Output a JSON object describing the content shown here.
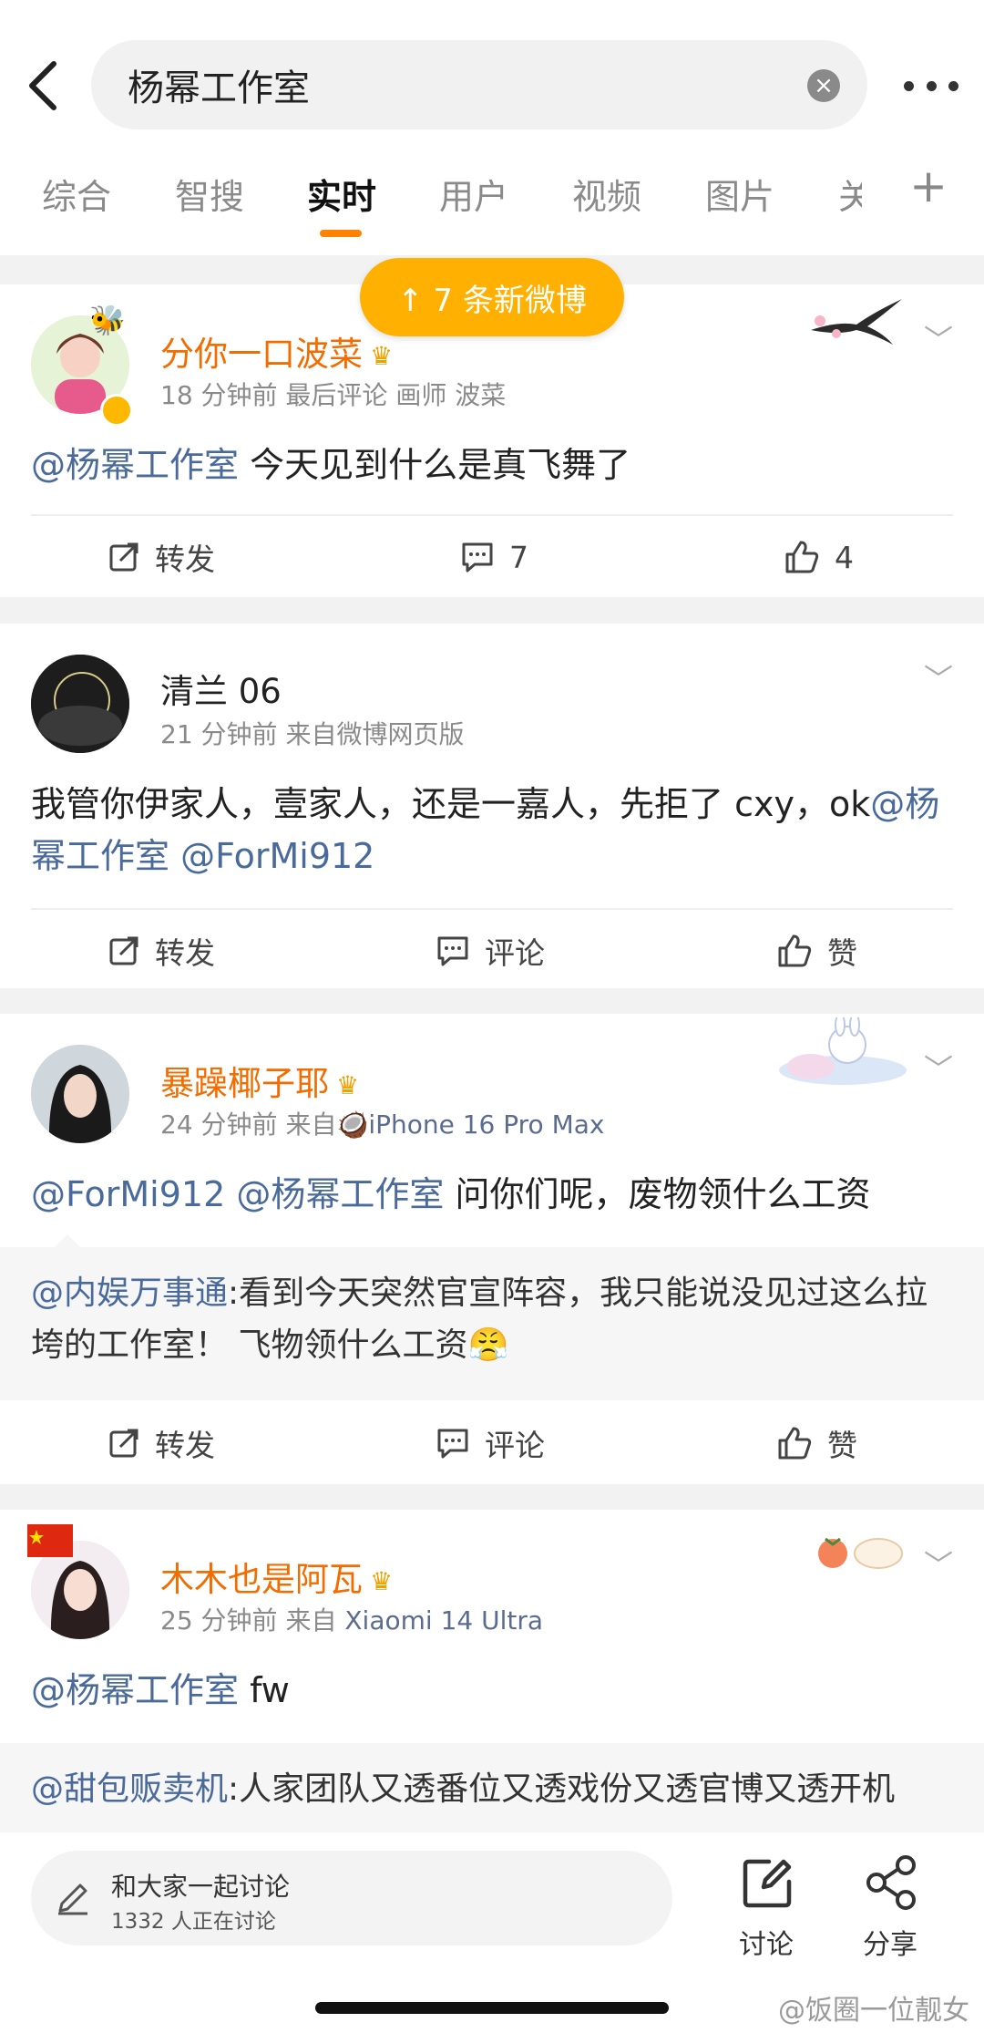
{
  "search": {
    "query": "杨幂工作室"
  },
  "tabs": [
    "综合",
    "智搜",
    "实时",
    "用户",
    "视频",
    "图片",
    "关"
  ],
  "new_posts": "↑  7 条新微博",
  "posts": [
    {
      "name": "分你一口波菜",
      "meta": "18 分钟前  最后评论   画师 波菜",
      "text_at": "@杨幂工作室",
      "text": " 今天见到什么是真飞舞了",
      "repost": "转发",
      "comment": "7",
      "like": "4"
    },
    {
      "name": "清兰 06",
      "meta_time": "21 分钟前",
      "meta_src": "来自微博网页版",
      "text_a": "我管你伊家人，壹家人，还是一嘉人，先拒了 cxy，ok",
      "text_at1": "@杨幂工作室",
      "text_at2": "@ForMi912",
      "repost": "转发",
      "comment": "评论",
      "like": "赞"
    },
    {
      "name": "暴躁椰子耶",
      "meta_time": "24 分钟前",
      "meta_from": "来自",
      "meta_src": "iPhone 16 Pro Max",
      "text_at1": "@ForMi912",
      "text_at2": "@杨幂工作室",
      "text": " 问你们呢，废物领什么工资",
      "quote_at": "@内娱万事通",
      "quote_text": ":看到今天突然官宣阵容，我只能说没见过这么拉垮的工作室！ 飞物领什么工资",
      "repost": "转发",
      "comment": "评论",
      "like": "赞"
    },
    {
      "name": "木木也是阿瓦",
      "meta_time": "25 分钟前",
      "meta_from": "来自",
      "meta_src": "Xiaomi 14 Ultra",
      "text_at": "@杨幂工作室",
      "text": " fw",
      "quote_at": "@甜包贩卖机",
      "quote_text": ":人家团队又透番位又透戏份又透官博又透开机"
    }
  ],
  "bottom": {
    "composer_title": "和大家一起讨论",
    "composer_sub": "1332 人正在讨论",
    "discuss": "讨论",
    "share": "分享"
  },
  "watermark": "@饭圈一位靓女"
}
